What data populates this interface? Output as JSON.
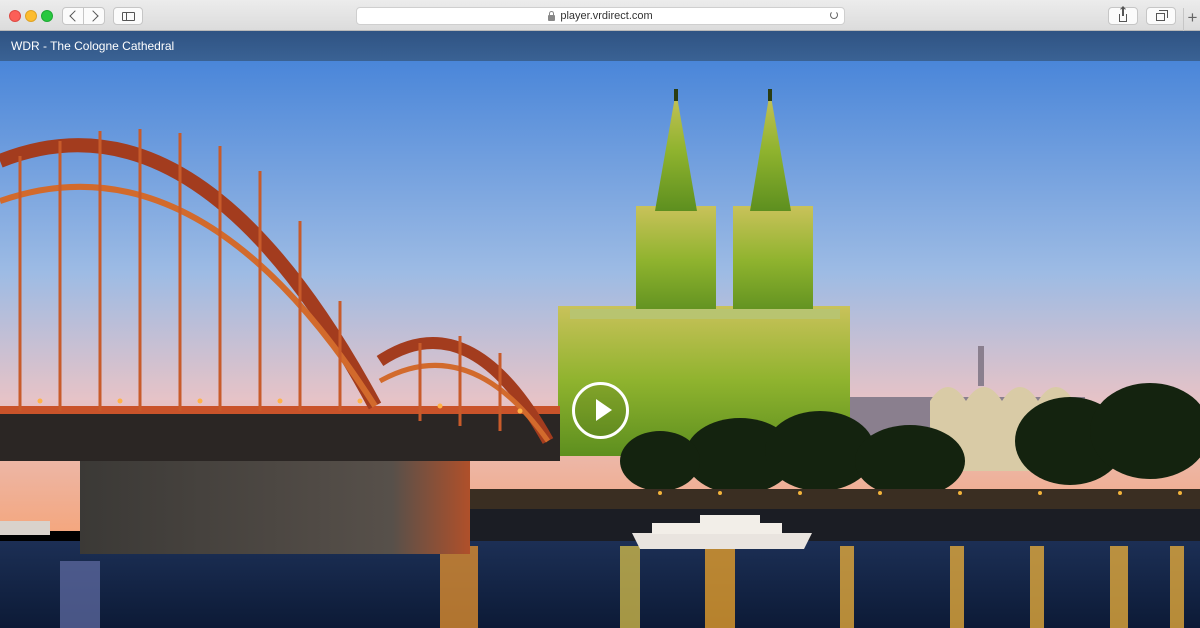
{
  "browser": {
    "url": "player.vrdirect.com",
    "new_tab_label": "+"
  },
  "page": {
    "title": "WDR - The Cologne Cathedral"
  },
  "icons": {
    "back": "chevron-left-icon",
    "forward": "chevron-right-icon",
    "sidebar": "sidebar-icon",
    "lock": "lock-icon",
    "reload": "reload-icon",
    "share": "share-icon",
    "tabs": "tabs-icon",
    "play": "play-icon"
  },
  "colors": {
    "title_bar": "#335a8b",
    "cathedral_glow": "#7fae2e",
    "sky_top": "#4a86d9",
    "sky_bottom": "#f4b08a"
  }
}
